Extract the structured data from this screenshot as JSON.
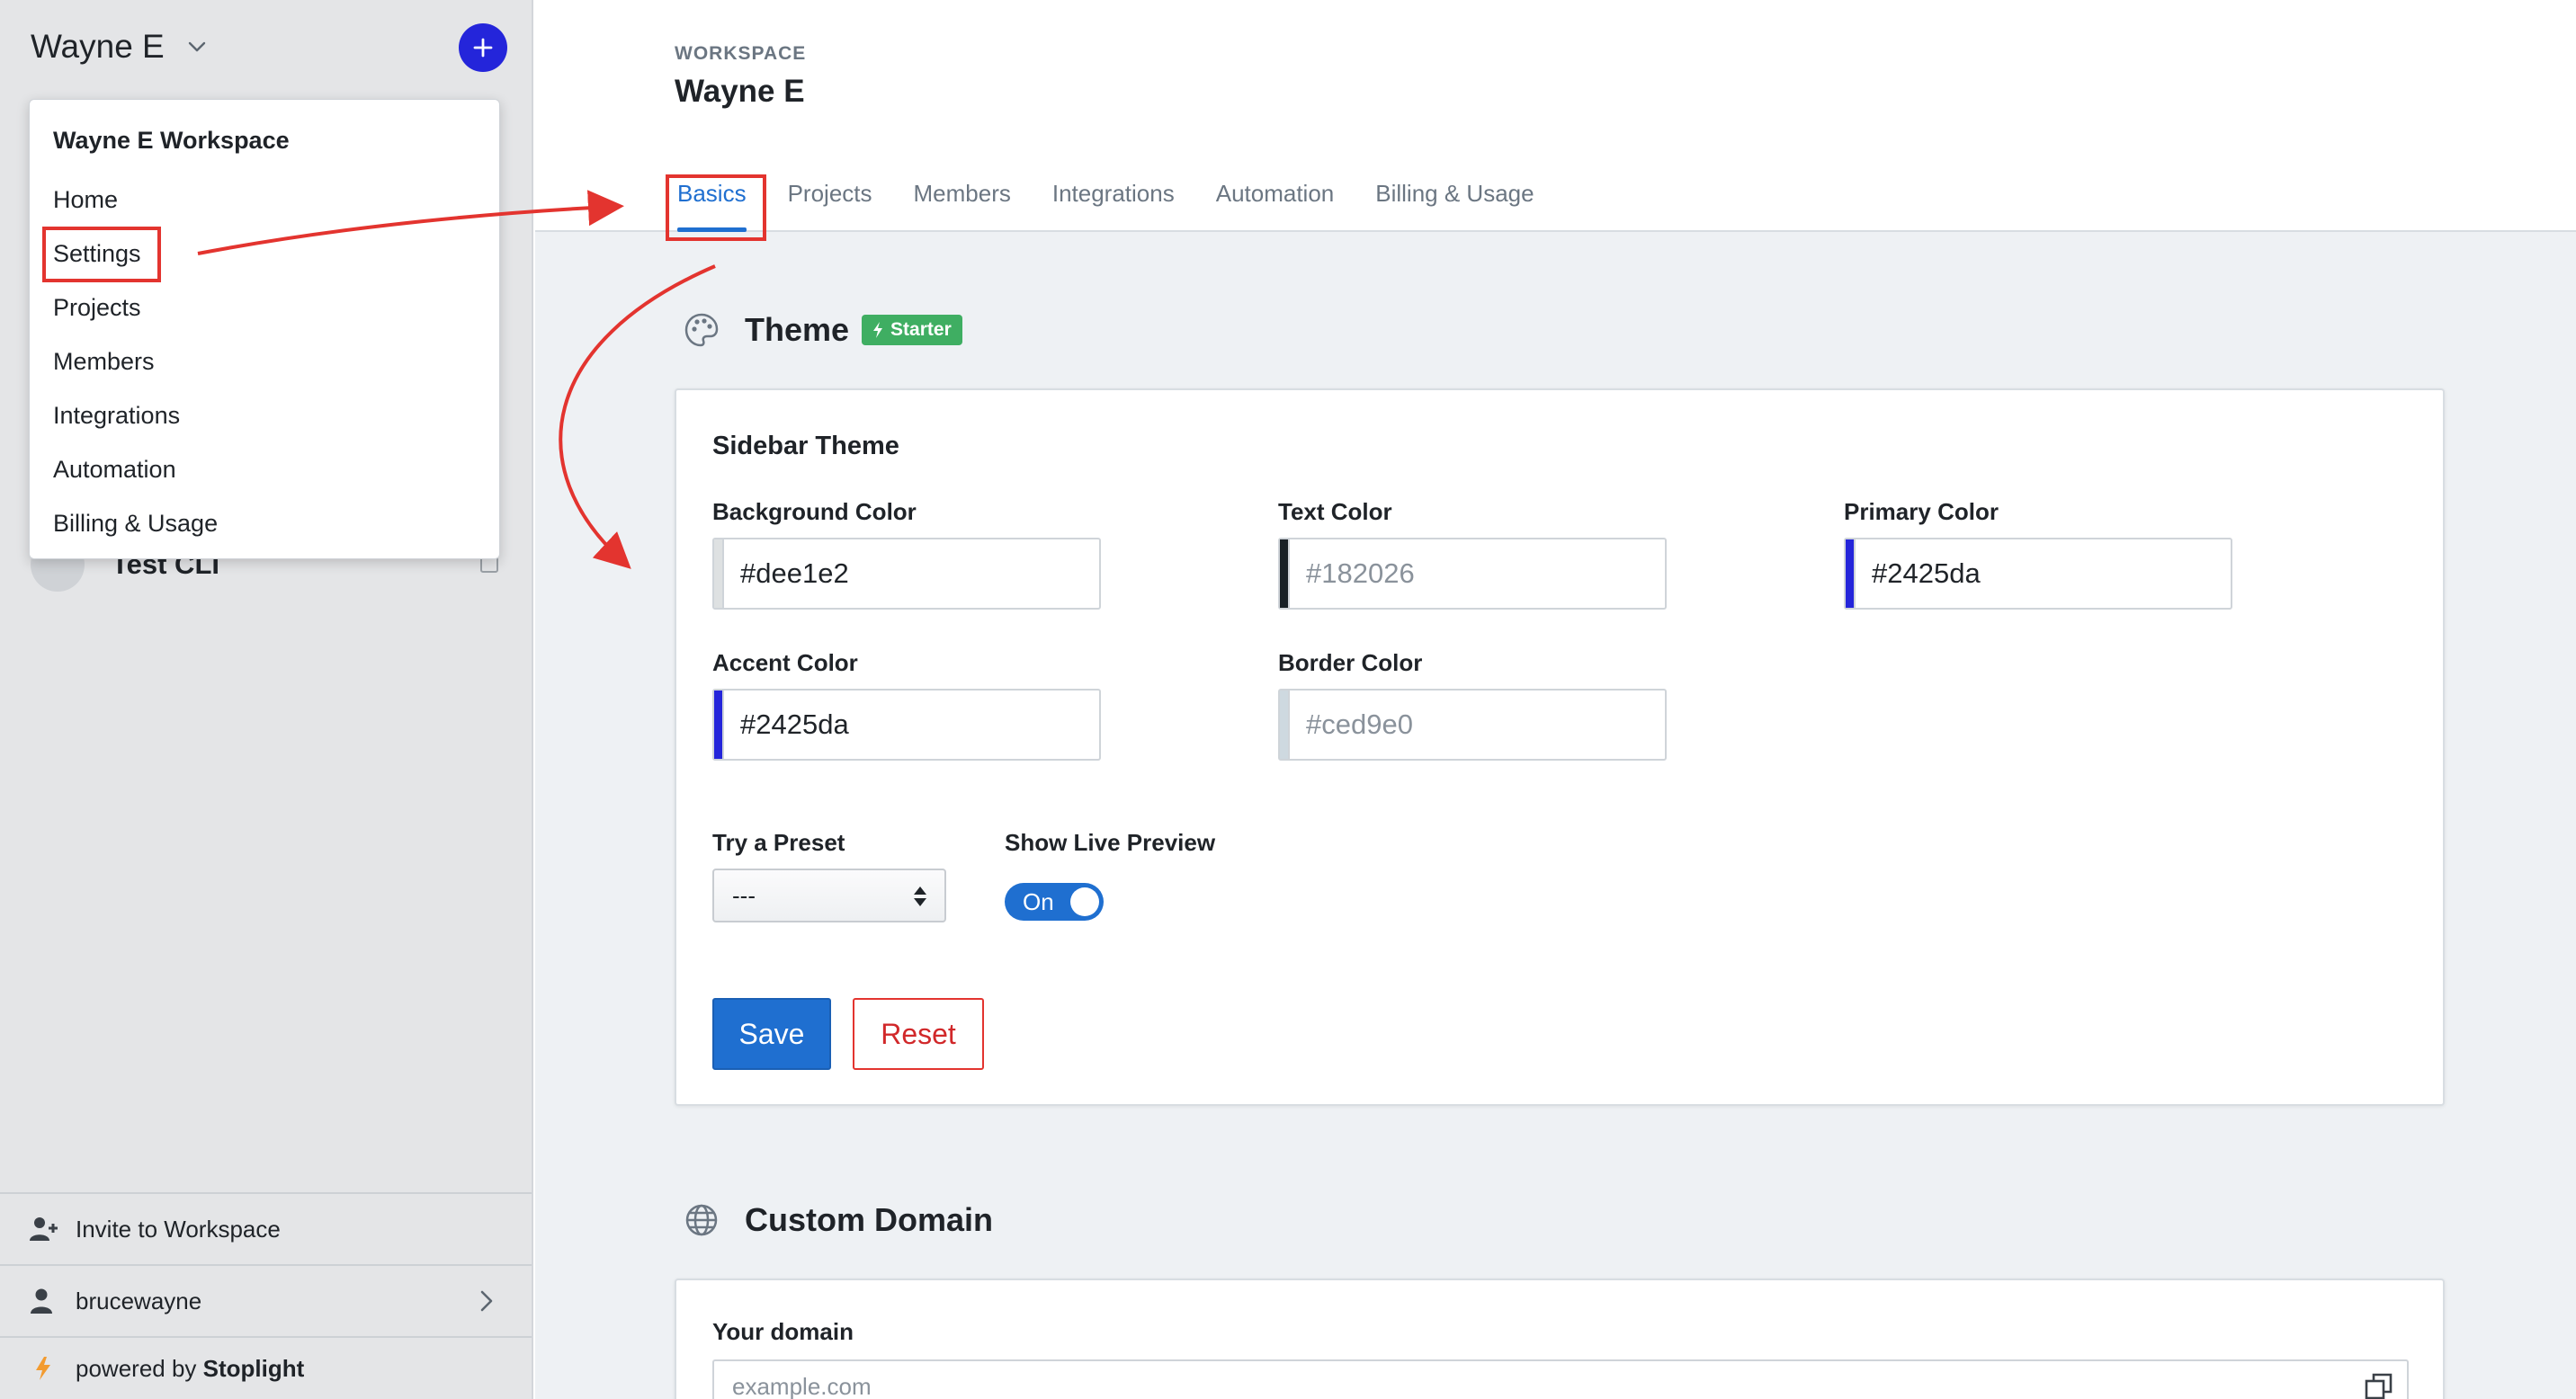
{
  "sidebar": {
    "workspace_name": "Wayne E",
    "project_label": "Test CLI",
    "menu": {
      "title": "Wayne E Workspace",
      "items": [
        "Home",
        "Settings",
        "Projects",
        "Members",
        "Integrations",
        "Automation",
        "Billing & Usage"
      ]
    },
    "footer": {
      "invite_label": "Invite to Workspace",
      "user_label": "brucewayne",
      "powered_prefix": "powered by",
      "powered_brand": "Stoplight"
    }
  },
  "header": {
    "eyebrow": "WORKSPACE",
    "title": "Wayne E",
    "tabs": [
      "Basics",
      "Projects",
      "Members",
      "Integrations",
      "Automation",
      "Billing & Usage"
    ],
    "active_tab": "Basics"
  },
  "theme": {
    "section_title": "Theme",
    "badge": "Starter",
    "card_title": "Sidebar Theme",
    "fields": {
      "background": {
        "label": "Background Color",
        "value": "#dee1e2",
        "swatch": "#dee1e2"
      },
      "text": {
        "label": "Text Color",
        "placeholder": "#182026",
        "swatch": "#182026"
      },
      "primary": {
        "label": "Primary Color",
        "value": "#2425da",
        "swatch": "#2425da"
      },
      "accent": {
        "label": "Accent Color",
        "value": "#2425da",
        "swatch": "#2425da"
      },
      "border": {
        "label": "Border Color",
        "placeholder": "#ced9e0",
        "swatch": "#ced9e0"
      }
    },
    "preset": {
      "label": "Try a Preset",
      "value": "---"
    },
    "live_preview": {
      "label": "Show Live Preview",
      "state": "On"
    },
    "save_label": "Save",
    "reset_label": "Reset"
  },
  "custom_domain": {
    "section_title": "Custom Domain",
    "field_label": "Your domain",
    "placeholder": "example.com"
  },
  "colors": {
    "brand_primary": "#2425da",
    "link_blue": "#1f6fd0",
    "annotation_red": "#e3342f",
    "badge_green": "#3fae62"
  },
  "icons": [
    "chevron-down-icon",
    "plus-icon",
    "palette-icon",
    "lightning-icon",
    "globe-icon",
    "user-plus-icon",
    "user-icon",
    "chevron-right-icon",
    "stoplight-logo-icon",
    "copy-icon",
    "sort-arrows-icon"
  ]
}
